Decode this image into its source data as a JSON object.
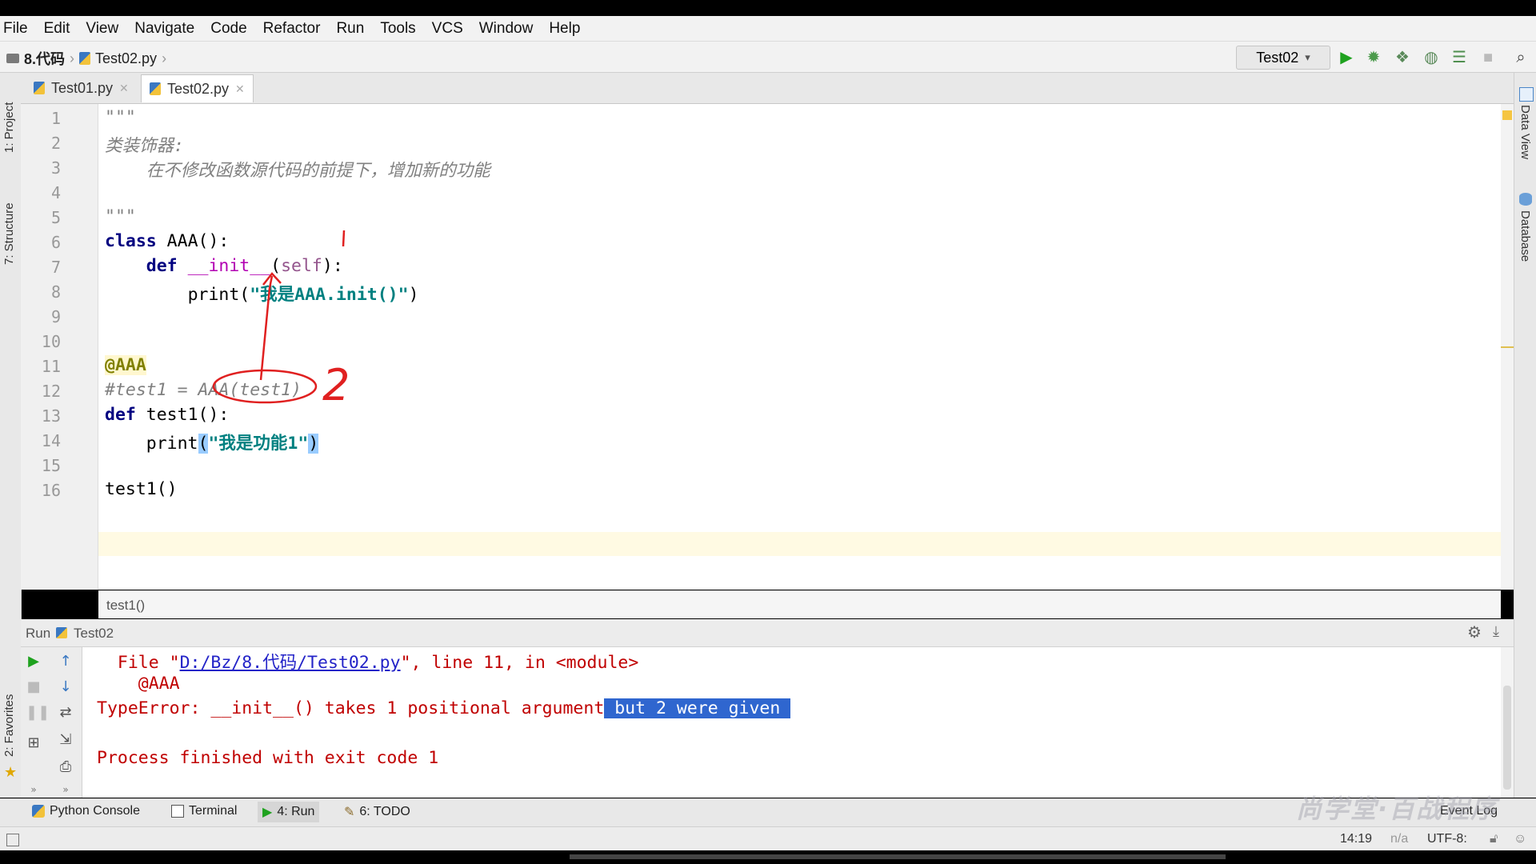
{
  "menu": [
    "File",
    "Edit",
    "View",
    "Navigate",
    "Code",
    "Refactor",
    "Run",
    "Tools",
    "VCS",
    "Window",
    "Help"
  ],
  "breadcrumb": {
    "project": "8.代码",
    "file": "Test02.py"
  },
  "run_config": "Test02",
  "tabs": [
    {
      "label": "Test01.py",
      "active": false
    },
    {
      "label": "Test02.py",
      "active": true
    }
  ],
  "side_tools": {
    "project": "1: Project",
    "structure": "7: Structure",
    "favorites": "2: Favorites",
    "data_view": "Data View",
    "database": "Database"
  },
  "line_numbers": [
    "1",
    "2",
    "3",
    "4",
    "5",
    "6",
    "7",
    "8",
    "9",
    "10",
    "11",
    "12",
    "13",
    "14",
    "15",
    "16"
  ],
  "code": {
    "l1": "\"\"\"",
    "l2": "类装饰器:",
    "l3": "    在不修改函数源代码的前提下，增加新的功能",
    "l5": "\"\"\"",
    "l6_kw": "class",
    "l6_rest": " AAA():",
    "l7_kw": "def",
    "l7_fn": "__init__",
    "l7_self": "self",
    "l8_print": "print(",
    "l8_str": "\"我是AAA.init()\"",
    "l8_close": ")",
    "l11": "@AAA",
    "l12": "#test1 = AAA(test1)",
    "l13_kw": "def",
    "l13_rest": " test1():",
    "l14_print": "print",
    "l14_open": "(",
    "l14_str": "\"我是功能1\"",
    "l14_close": ")",
    "l16": "test1()"
  },
  "editor_breadcrumb": "test1()",
  "run_panel": {
    "label": "Run",
    "config": "Test02"
  },
  "console": {
    "line1_pre": "  File \"",
    "line1_link": "D:/Bz/8.代码/Test02.py",
    "line1_post": "\", line 11, in <module>",
    "line2": "    @AAA",
    "line3_pre": "TypeError: __init__() takes 1 positional argument",
    "line3_sel": " but 2 were given ",
    "line5": "Process finished with exit code 1"
  },
  "toolwindows": [
    {
      "label": "Python Console",
      "icon": "python-icon"
    },
    {
      "label": "Terminal",
      "icon": "terminal-icon"
    },
    {
      "label": "4: Run",
      "icon": "run-icon"
    },
    {
      "label": "6: TODO",
      "icon": "todo-icon"
    }
  ],
  "event_log": "Event Log",
  "status": {
    "position": "14:19",
    "na": "n/a",
    "encoding": "UTF-8:"
  },
  "watermark": "尚学堂·百战程序",
  "annotation": "2",
  "colors": {
    "keyword": "#000080",
    "string": "#008080",
    "comment": "#808080",
    "error": "#c00000",
    "selection": "#2f66cf",
    "annotation_ink": "#e02020"
  }
}
